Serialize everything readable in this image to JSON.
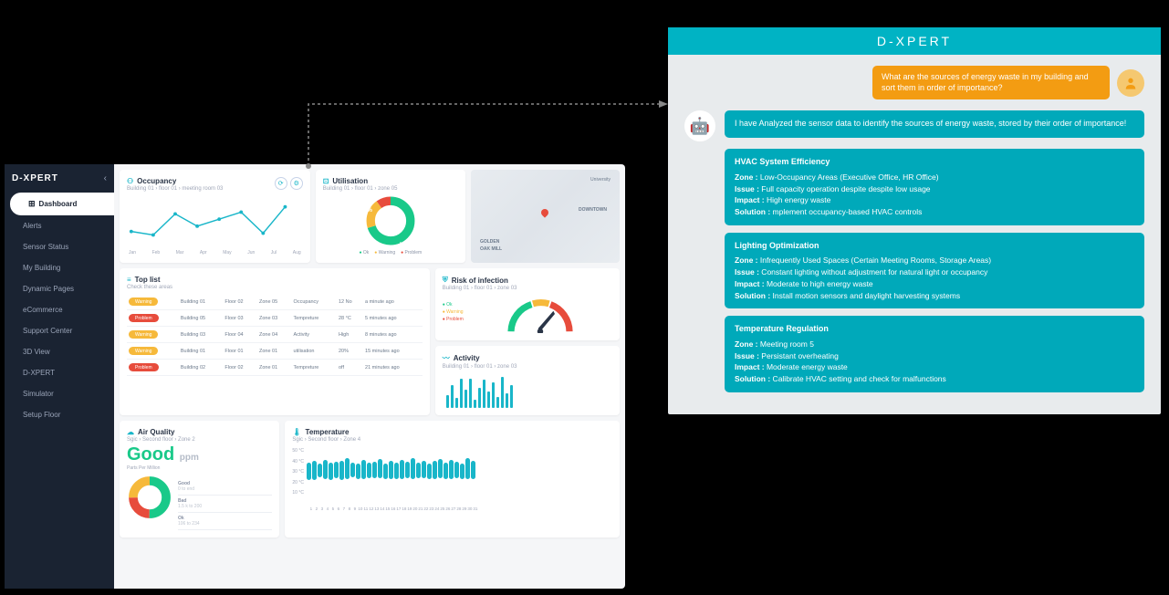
{
  "brand": "D-XPERT",
  "sidebar": {
    "items": [
      "Dashboard",
      "Alerts",
      "Sensor Status",
      "My Building",
      "Dynamic Pages",
      "eCommerce",
      "Support Center",
      "3D View",
      "D-XPERT",
      "Simulator",
      "Setup Floor"
    ]
  },
  "occupancy": {
    "title": "Occupancy",
    "sub": "Building 01 › floor 01 › meeting room 03",
    "months": [
      "Jan",
      "Feb",
      "Mar",
      "Apr",
      "May",
      "Jun",
      "Jul",
      "Aug"
    ]
  },
  "utilisation": {
    "title": "Utilisation",
    "sub": "Building 01 › floor 01 › zone 05",
    "segments": {
      "ok": 70,
      "warning": 20,
      "problem": 10
    },
    "legend": {
      "ok": "Ok",
      "warn": "Warning",
      "prob": "Problem"
    }
  },
  "map": {
    "labels": [
      "University",
      "GOLDEN",
      "OAK MILL",
      "DOWNTOWN"
    ]
  },
  "toplist": {
    "title": "Top list",
    "sub": "Check these areas",
    "rows": [
      {
        "status": "Warning",
        "cls": "b-warn",
        "b": "Building 01",
        "f": "Floor 02",
        "z": "Zone 05",
        "metric": "Occupancy",
        "val": "12 No",
        "ago": "a minute ago"
      },
      {
        "status": "Problem",
        "cls": "b-prob",
        "b": "Building 05",
        "f": "Floor 03",
        "z": "Zone 03",
        "metric": "Tempreture",
        "val": "28 °C",
        "ago": "5 minutes ago"
      },
      {
        "status": "Warning",
        "cls": "b-warn",
        "b": "Building 03",
        "f": "Floor 04",
        "z": "Zone 04",
        "metric": "Activity",
        "val": "High",
        "ago": "8 minutes ago"
      },
      {
        "status": "Warning",
        "cls": "b-warn",
        "b": "Building 01",
        "f": "Floor 01",
        "z": "Zone 01",
        "metric": "utilisation",
        "val": "20%",
        "ago": "15 minutes ago"
      },
      {
        "status": "Problem",
        "cls": "b-prob",
        "b": "Building 02",
        "f": "Floor 02",
        "z": "Zone 01",
        "metric": "Tempreture",
        "val": "off",
        "ago": "21 minutes ago"
      }
    ]
  },
  "risk": {
    "title": "Risk of infection",
    "sub": "Building 01 › floor 01 › zone 03",
    "legend": [
      "Ok",
      "Warning",
      "Problem"
    ]
  },
  "activity": {
    "title": "Activity",
    "sub": "Building 01 › floor 01 › zone 03"
  },
  "airq": {
    "title": "Air Quality",
    "sub": "Sgic › Second floor › Zone 2",
    "value": "Good",
    "unit": "ppm",
    "sub2": "Parts Per Million",
    "legend": [
      {
        "label": "Good",
        "range": "0 to end"
      },
      {
        "label": "Bad",
        "range": "1.5 k to 200"
      },
      {
        "label": "Ok",
        "range": "106 to 234"
      }
    ]
  },
  "temp": {
    "title": "Temperature",
    "sub": "Sgic › Second floor › Zone 4",
    "yaxis": [
      "50 °C",
      "40 °C",
      "30 °C",
      "20 °C",
      "10 °C"
    ],
    "days": 31
  },
  "chat": {
    "header": "D-XPERT",
    "user_msg": "What are the sources of energy waste in my building and sort them in order of importance?",
    "bot_intro": "I have Analyzed the sensor data to identify the sources of energy waste, stored by their order of importance!",
    "sections": [
      {
        "title": "HVAC System Efficiency",
        "zone": "Low-Occupancy  Areas (Executive Office, HR Office)",
        "issue": "Full capacity operation despite despite low usage",
        "impact": "High energy waste",
        "solution": "mplement occupancy-based HVAC controls"
      },
      {
        "title": "Lighting Optimization",
        "zone": "Infrequently Used Spaces (Certain Meeting Rooms, Storage Areas)",
        "issue": "Constant lighting without adjustment for natural light or occupancy",
        "impact": "Moderate to high energy waste",
        "solution": "Install motion sensors and daylight harvesting systems"
      },
      {
        "title": "Temperature Regulation",
        "zone": "Meeting room 5",
        "issue": "Persistant overheating",
        "impact": "Moderate energy waste",
        "solution": "Calibrate HVAC setting and check for malfunctions"
      }
    ]
  },
  "chart_data": {
    "occupancy_line": {
      "type": "line",
      "x": [
        "Jan",
        "Feb",
        "Mar",
        "Apr",
        "May",
        "Jun",
        "Jul",
        "Aug"
      ],
      "values": [
        22,
        18,
        45,
        30,
        40,
        48,
        20,
        55
      ]
    },
    "utilisation_donut": {
      "type": "pie",
      "series": [
        {
          "name": "Ok",
          "value": 70,
          "color": "#19c989"
        },
        {
          "name": "Warning",
          "value": 20,
          "color": "#f6b93b"
        },
        {
          "name": "Problem",
          "value": 10,
          "color": "#e74c3c"
        }
      ]
    },
    "risk_gauge": {
      "type": "gauge",
      "value": 65,
      "zones": [
        "ok",
        "warning",
        "problem"
      ]
    },
    "activity_bars": {
      "type": "bar",
      "values": [
        40,
        70,
        30,
        90,
        55,
        88,
        25,
        60,
        85,
        50,
        78,
        32,
        95,
        45,
        70
      ]
    },
    "airq_donut": {
      "type": "pie",
      "series": [
        {
          "name": "Good",
          "value": 50,
          "color": "#19c989"
        },
        {
          "name": "Bad",
          "value": 25,
          "color": "#e74c3c"
        },
        {
          "name": "Ok",
          "value": 25,
          "color": "#f6b93b"
        }
      ]
    },
    "temperature_range": {
      "type": "bar",
      "xlabel": "day",
      "ylabel": "°C",
      "ylim": [
        10,
        50
      ],
      "categories": [
        1,
        2,
        3,
        4,
        5,
        6,
        7,
        8,
        9,
        10,
        11,
        12,
        13,
        14,
        15,
        16,
        17,
        18,
        19,
        20,
        21,
        22,
        23,
        24,
        25,
        26,
        27,
        28,
        29,
        30,
        31
      ],
      "low": [
        18,
        20,
        19,
        21,
        18,
        20,
        19,
        22,
        20,
        18,
        21,
        19,
        20,
        22,
        18,
        20,
        19,
        21,
        20,
        22,
        19,
        21,
        18,
        20,
        22,
        19,
        21,
        20,
        18,
        22,
        20
      ],
      "high": [
        32,
        35,
        30,
        36,
        31,
        33,
        34,
        38,
        32,
        30,
        36,
        31,
        33,
        37,
        30,
        34,
        32,
        36,
        33,
        38,
        31,
        35,
        30,
        34,
        37,
        32,
        36,
        33,
        30,
        38,
        34
      ]
    }
  }
}
